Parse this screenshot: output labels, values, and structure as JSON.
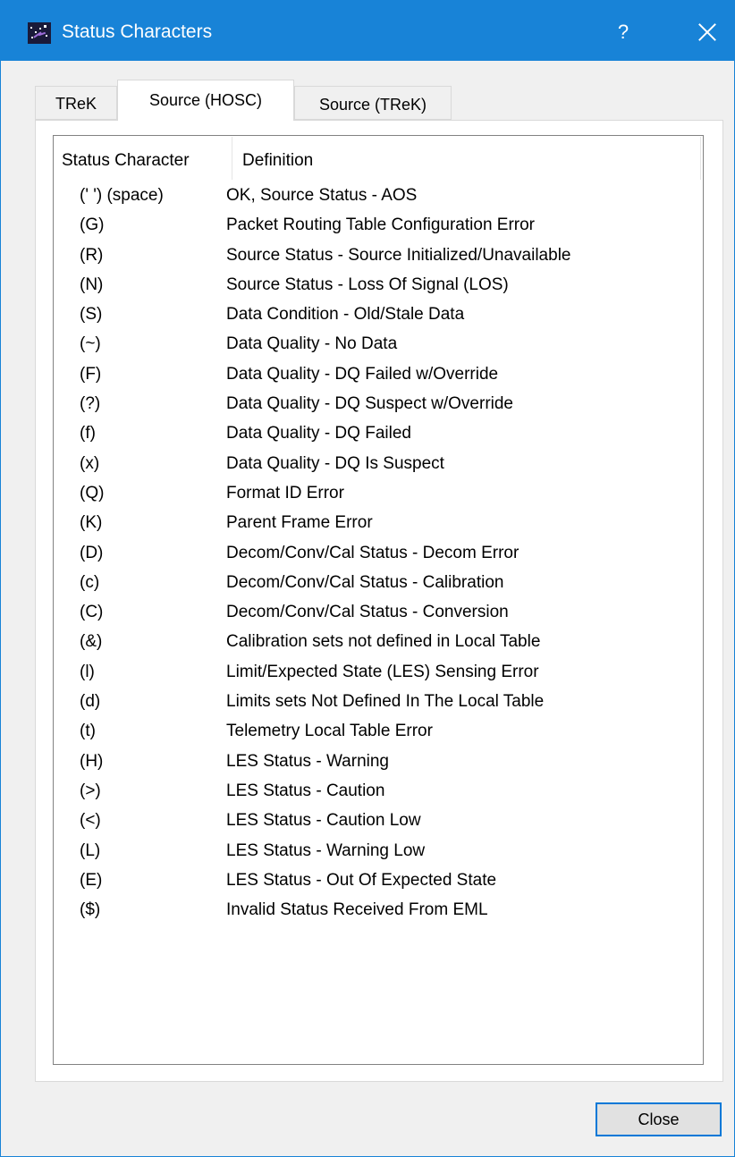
{
  "window": {
    "title": "Status Characters",
    "help_label": "?",
    "close_icon": "close-icon"
  },
  "tabs": [
    {
      "label": "TReK",
      "selected": false
    },
    {
      "label": "Source (HOSC)",
      "selected": true
    },
    {
      "label": "Source (TReK)",
      "selected": false
    }
  ],
  "table": {
    "columns": [
      "Status Character",
      "Definition"
    ],
    "rows": [
      [
        "(' ') (space)",
        "OK, Source Status - AOS"
      ],
      [
        "(G)",
        "Packet Routing Table Configuration Error"
      ],
      [
        "(R)",
        "Source Status - Source Initialized/Unavailable"
      ],
      [
        "(N)",
        "Source Status - Loss Of Signal (LOS)"
      ],
      [
        "(S)",
        "Data Condition - Old/Stale Data"
      ],
      [
        "(~)",
        "Data Quality - No Data"
      ],
      [
        "(F)",
        "Data Quality - DQ Failed w/Override"
      ],
      [
        "(?)",
        "Data Quality - DQ Suspect w/Override"
      ],
      [
        "(f)",
        "Data Quality - DQ Failed"
      ],
      [
        "(x)",
        "Data Quality - DQ Is Suspect"
      ],
      [
        "(Q)",
        "Format ID Error"
      ],
      [
        "(K)",
        "Parent Frame Error"
      ],
      [
        "(D)",
        "Decom/Conv/Cal Status - Decom Error"
      ],
      [
        "(c)",
        "Decom/Conv/Cal Status - Calibration"
      ],
      [
        "(C)",
        "Decom/Conv/Cal Status - Conversion"
      ],
      [
        "(&)",
        "Calibration sets not defined in Local Table"
      ],
      [
        "(l)",
        "Limit/Expected State (LES) Sensing Error"
      ],
      [
        "(d)",
        "Limits sets Not Defined In The Local Table"
      ],
      [
        "(t)",
        "Telemetry Local Table Error"
      ],
      [
        "(H)",
        "LES Status - Warning"
      ],
      [
        "(>)",
        "LES Status - Caution"
      ],
      [
        "(<)",
        "LES Status - Caution Low"
      ],
      [
        "(L)",
        "LES Status - Warning Low"
      ],
      [
        "(E)",
        "LES Status - Out Of Expected State"
      ],
      [
        "($)",
        "Invalid Status Received From EML"
      ]
    ]
  },
  "footer": {
    "close_label": "Close"
  },
  "colors": {
    "titlebar": "#1883d7",
    "button_focus_border": "#0078d7"
  }
}
